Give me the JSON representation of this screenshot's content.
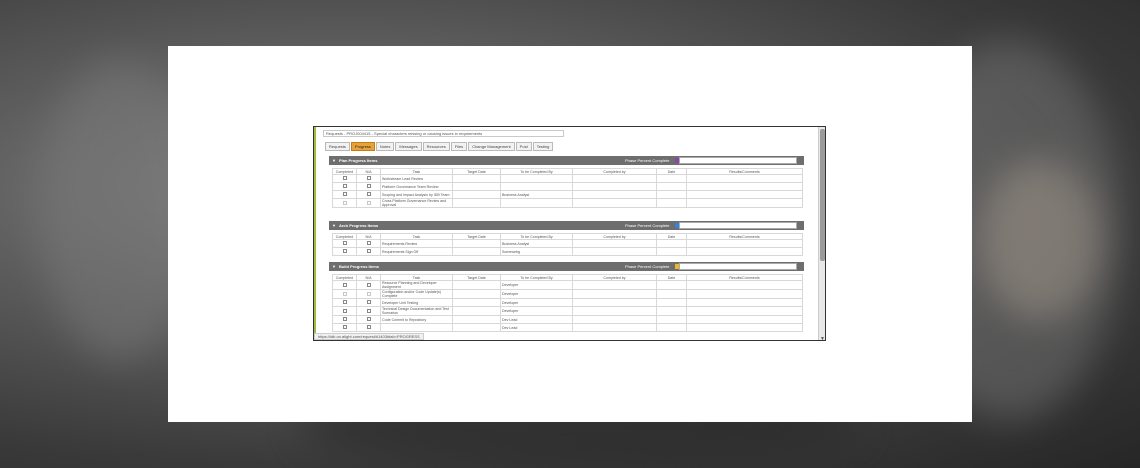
{
  "request": {
    "title": "Requests - PROJ004415 - Special characters missing or causing issues in requirements"
  },
  "tabs": [
    {
      "label": "Requests",
      "active": false
    },
    {
      "label": "Progress",
      "active": true
    },
    {
      "label": "Notes",
      "active": false
    },
    {
      "label": "Messages",
      "active": false
    },
    {
      "label": "Resources",
      "active": false
    },
    {
      "label": "Files",
      "active": false
    },
    {
      "label": "Change Management",
      "active": false
    },
    {
      "label": "Post",
      "active": false
    },
    {
      "label": "Testing",
      "active": false
    }
  ],
  "columns": [
    "Completed",
    "N/A",
    "Task",
    "Target Date",
    "To be Completed By",
    "Completed by",
    "Date",
    "Results/Comments"
  ],
  "phase_label": "Phase Percent Complete",
  "sections": [
    {
      "title": "Plan Progress Items",
      "swatch_color": "#8e44ad",
      "rows": [
        {
          "task": "Workstream Lead Review",
          "target_date": "",
          "to_be_completed_by": "",
          "dim": false
        },
        {
          "task": "Platform Governance Team Review",
          "target_date": "",
          "to_be_completed_by": "",
          "dim": false
        },
        {
          "task": "Scoping and Impact Analysis by IDB Team",
          "target_date": "",
          "to_be_completed_by": "Business Analyst",
          "dim": false
        },
        {
          "task": "Cross Platform Governance Review and Approval",
          "target_date": "",
          "to_be_completed_by": "",
          "dim": true
        }
      ]
    },
    {
      "title": "Arch Progress Items",
      "swatch_color": "#2e86de",
      "rows": [
        {
          "task": "Requirements Review",
          "target_date": "",
          "to_be_completed_by": "Business Analyst",
          "dim": false
        },
        {
          "task": "Requirements Sign Off",
          "target_date": "",
          "to_be_completed_by": "Somewebg",
          "dim": false
        }
      ]
    },
    {
      "title": "Build Progress Items",
      "swatch_color": "#f0b429",
      "rows": [
        {
          "task": "Resource Planning and Developer Assignment",
          "target_date": "",
          "to_be_completed_by": "Developer",
          "dim": false
        },
        {
          "task": "Configuration and/or Code Update(s) Complete",
          "target_date": "",
          "to_be_completed_by": "Developer",
          "dim": true
        },
        {
          "task": "Developer Unit Testing",
          "target_date": "",
          "to_be_completed_by": "Developer",
          "dim": false
        },
        {
          "task": "Technical Design Documentation and Test Scenarios",
          "target_date": "",
          "to_be_completed_by": "Developer",
          "dim": false
        },
        {
          "task": "Code Commit to Repository",
          "target_date": "",
          "to_be_completed_by": "Dev Lead",
          "dim": false
        },
        {
          "task": "",
          "target_date": "",
          "to_be_completed_by": "Dev Lead",
          "dim": false
        }
      ]
    }
  ],
  "status_url": "https://idb.on.alight.com/request/#1403#tab=PROGRESS"
}
